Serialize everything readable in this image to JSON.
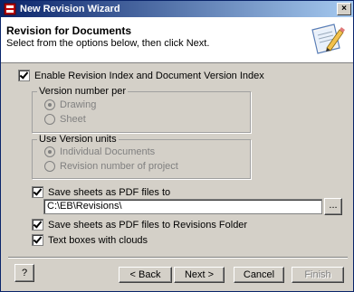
{
  "window": {
    "title": "New Revision Wizard",
    "close_glyph": "×"
  },
  "header": {
    "title": "Revision for Documents",
    "subtitle": "Select from the options below, then click Next.",
    "icon": "document-pencil-icon"
  },
  "options": {
    "enable_index": {
      "label": "Enable Revision Index and Document Version Index",
      "checked": true
    },
    "version_per": {
      "legend": "Version number per",
      "options": [
        {
          "label": "Drawing",
          "selected": true
        },
        {
          "label": "Sheet",
          "selected": false
        }
      ]
    },
    "version_units": {
      "legend": "Use Version units",
      "options": [
        {
          "label": "Individual Documents",
          "selected": true
        },
        {
          "label": "Revision number of project",
          "selected": false
        }
      ]
    },
    "save_pdf": {
      "label": "Save sheets as PDF files to",
      "checked": true
    },
    "pdf_path": {
      "value": "C:\\EB\\Revisions\\"
    },
    "browse_label": "...",
    "save_pdf_revisions": {
      "label": "Save sheets as PDF files to Revisions Folder",
      "checked": true
    },
    "text_clouds": {
      "label": "Text boxes with clouds",
      "checked": true
    }
  },
  "footer": {
    "help_label": "?",
    "back_label": "< Back",
    "next_label": "Next >",
    "cancel_label": "Cancel",
    "finish_label": "Finish"
  }
}
